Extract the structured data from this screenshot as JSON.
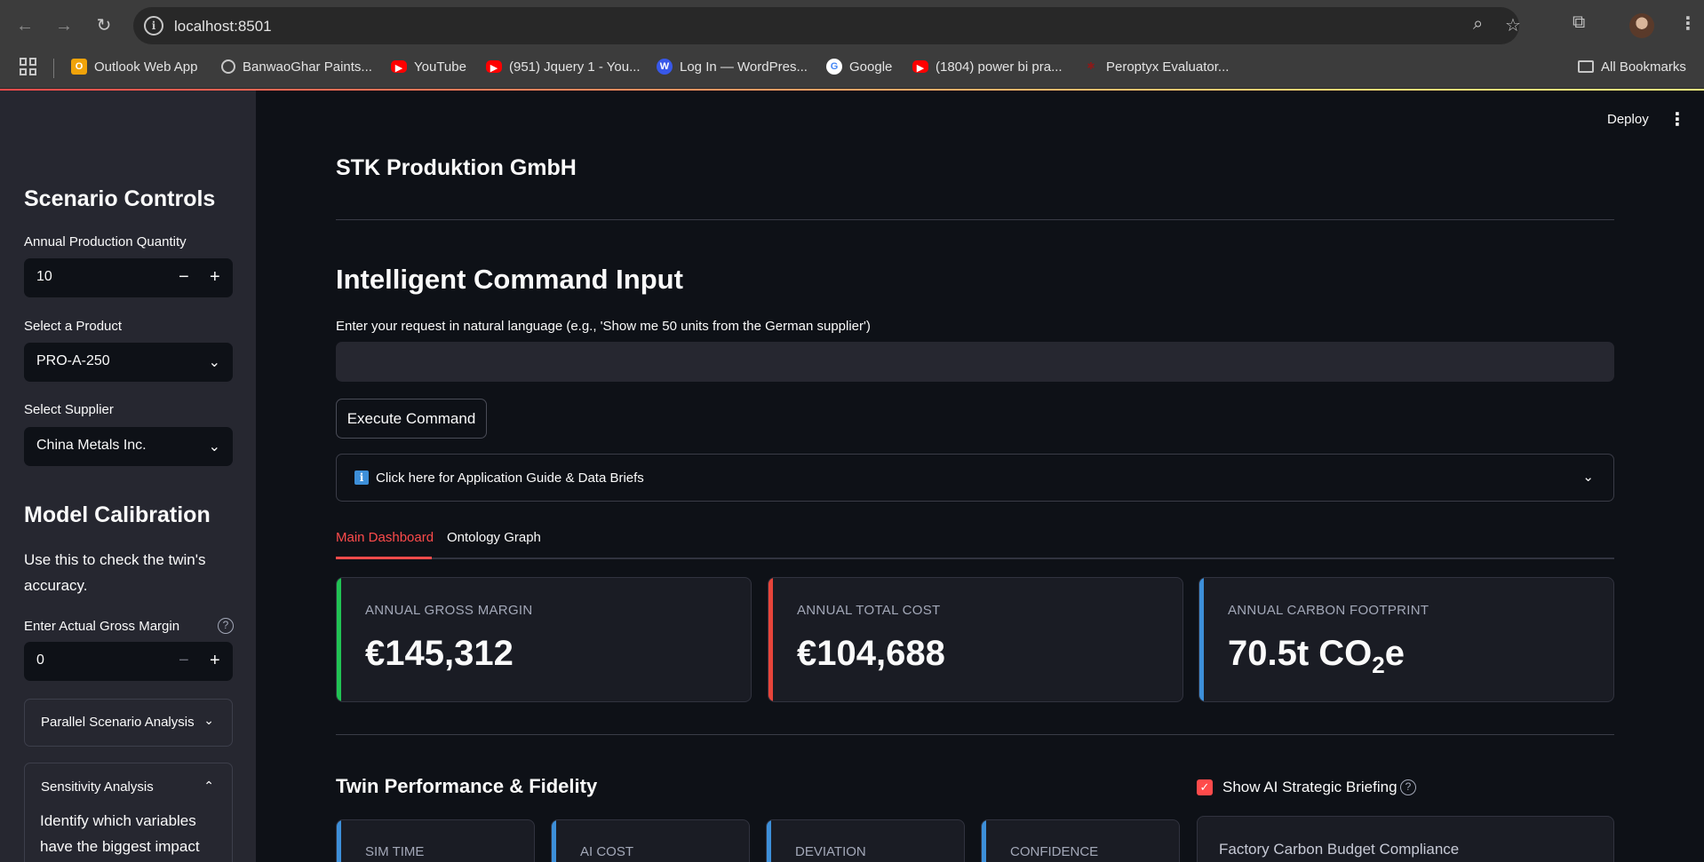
{
  "browser": {
    "url": "localhost:8501",
    "bookmarks": [
      {
        "label": "Outlook Web App"
      },
      {
        "label": "BanwaoGhar Paints..."
      },
      {
        "label": "YouTube"
      },
      {
        "label": "(951) Jquery 1 - You..."
      },
      {
        "label": "Log In — WordPres..."
      },
      {
        "label": "Google"
      },
      {
        "label": "(1804) power bi pra..."
      },
      {
        "label": "Peroptyx Evaluator..."
      }
    ],
    "all_bookmarks": "All Bookmarks"
  },
  "app": {
    "deploy": "Deploy"
  },
  "sidebar": {
    "scenario_heading": "Scenario Controls",
    "qty_label": "Annual Production Quantity",
    "qty_value": "10",
    "product_label": "Select a Product",
    "product_value": "PRO-A-250",
    "supplier_label": "Select Supplier",
    "supplier_value": "China Metals Inc.",
    "calibration_heading": "Model Calibration",
    "calibration_text": "Use this to check the twin's accuracy.",
    "gross_margin_label": "Enter Actual Gross Margin",
    "gross_margin_value": "0",
    "parallel_label": "Parallel Scenario Analysis",
    "sensitivity_label": "Sensitivity Analysis",
    "sensitivity_text": "Identify which variables have the biggest impact"
  },
  "main": {
    "company": "STK Produktion GmbH",
    "command_heading": "Intelligent Command Input",
    "command_label": "Enter your request in natural language (e.g., 'Show me 50 units from the German supplier')",
    "command_value": "",
    "execute_label": "Execute Command",
    "guide_label": "Click here for Application Guide & Data Briefs",
    "tabs": [
      {
        "label": "Main Dashboard"
      },
      {
        "label": "Ontology Graph"
      }
    ],
    "metrics": [
      {
        "label": "ANNUAL GROSS MARGIN",
        "value": "€145,312",
        "color": "#21c354"
      },
      {
        "label": "ANNUAL TOTAL COST",
        "value": "€104,688",
        "color": "#e8443a"
      },
      {
        "label": "ANNUAL CARBON FOOTPRINT",
        "value_main": "70.5t CO",
        "value_sub": "2",
        "value_end": "e",
        "color": "#3d8fd9"
      }
    ],
    "twin_heading": "Twin Performance & Fidelity",
    "show_briefing_label": "Show AI Strategic Briefing",
    "show_briefing_checked": true,
    "small_metrics": [
      {
        "label": "SIM TIME"
      },
      {
        "label": "AI COST"
      },
      {
        "label": "DEVIATION"
      },
      {
        "label": "CONFIDENCE"
      }
    ],
    "briefing_title": "Factory Carbon Budget Compliance"
  }
}
